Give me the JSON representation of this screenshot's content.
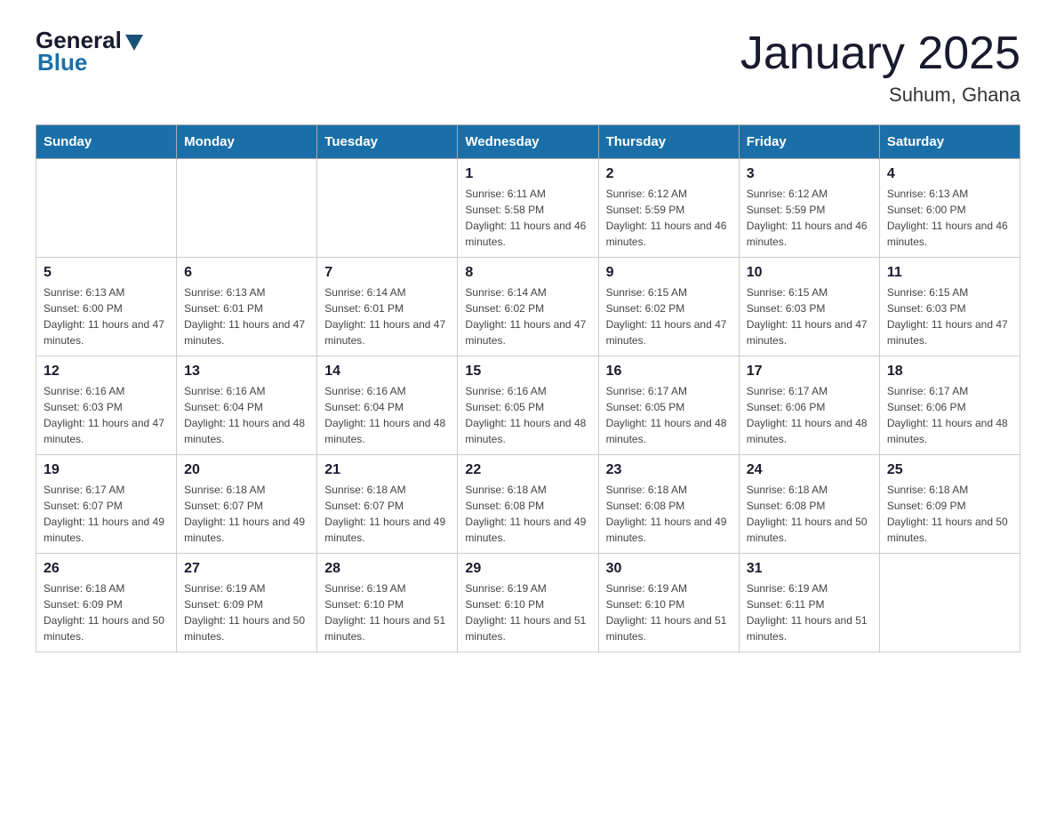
{
  "logo": {
    "general": "General",
    "blue": "Blue"
  },
  "title": "January 2025",
  "subtitle": "Suhum, Ghana",
  "days_header": [
    "Sunday",
    "Monday",
    "Tuesday",
    "Wednesday",
    "Thursday",
    "Friday",
    "Saturday"
  ],
  "weeks": [
    [
      {
        "day": "",
        "info": ""
      },
      {
        "day": "",
        "info": ""
      },
      {
        "day": "",
        "info": ""
      },
      {
        "day": "1",
        "info": "Sunrise: 6:11 AM\nSunset: 5:58 PM\nDaylight: 11 hours and 46 minutes."
      },
      {
        "day": "2",
        "info": "Sunrise: 6:12 AM\nSunset: 5:59 PM\nDaylight: 11 hours and 46 minutes."
      },
      {
        "day": "3",
        "info": "Sunrise: 6:12 AM\nSunset: 5:59 PM\nDaylight: 11 hours and 46 minutes."
      },
      {
        "day": "4",
        "info": "Sunrise: 6:13 AM\nSunset: 6:00 PM\nDaylight: 11 hours and 46 minutes."
      }
    ],
    [
      {
        "day": "5",
        "info": "Sunrise: 6:13 AM\nSunset: 6:00 PM\nDaylight: 11 hours and 47 minutes."
      },
      {
        "day": "6",
        "info": "Sunrise: 6:13 AM\nSunset: 6:01 PM\nDaylight: 11 hours and 47 minutes."
      },
      {
        "day": "7",
        "info": "Sunrise: 6:14 AM\nSunset: 6:01 PM\nDaylight: 11 hours and 47 minutes."
      },
      {
        "day": "8",
        "info": "Sunrise: 6:14 AM\nSunset: 6:02 PM\nDaylight: 11 hours and 47 minutes."
      },
      {
        "day": "9",
        "info": "Sunrise: 6:15 AM\nSunset: 6:02 PM\nDaylight: 11 hours and 47 minutes."
      },
      {
        "day": "10",
        "info": "Sunrise: 6:15 AM\nSunset: 6:03 PM\nDaylight: 11 hours and 47 minutes."
      },
      {
        "day": "11",
        "info": "Sunrise: 6:15 AM\nSunset: 6:03 PM\nDaylight: 11 hours and 47 minutes."
      }
    ],
    [
      {
        "day": "12",
        "info": "Sunrise: 6:16 AM\nSunset: 6:03 PM\nDaylight: 11 hours and 47 minutes."
      },
      {
        "day": "13",
        "info": "Sunrise: 6:16 AM\nSunset: 6:04 PM\nDaylight: 11 hours and 48 minutes."
      },
      {
        "day": "14",
        "info": "Sunrise: 6:16 AM\nSunset: 6:04 PM\nDaylight: 11 hours and 48 minutes."
      },
      {
        "day": "15",
        "info": "Sunrise: 6:16 AM\nSunset: 6:05 PM\nDaylight: 11 hours and 48 minutes."
      },
      {
        "day": "16",
        "info": "Sunrise: 6:17 AM\nSunset: 6:05 PM\nDaylight: 11 hours and 48 minutes."
      },
      {
        "day": "17",
        "info": "Sunrise: 6:17 AM\nSunset: 6:06 PM\nDaylight: 11 hours and 48 minutes."
      },
      {
        "day": "18",
        "info": "Sunrise: 6:17 AM\nSunset: 6:06 PM\nDaylight: 11 hours and 48 minutes."
      }
    ],
    [
      {
        "day": "19",
        "info": "Sunrise: 6:17 AM\nSunset: 6:07 PM\nDaylight: 11 hours and 49 minutes."
      },
      {
        "day": "20",
        "info": "Sunrise: 6:18 AM\nSunset: 6:07 PM\nDaylight: 11 hours and 49 minutes."
      },
      {
        "day": "21",
        "info": "Sunrise: 6:18 AM\nSunset: 6:07 PM\nDaylight: 11 hours and 49 minutes."
      },
      {
        "day": "22",
        "info": "Sunrise: 6:18 AM\nSunset: 6:08 PM\nDaylight: 11 hours and 49 minutes."
      },
      {
        "day": "23",
        "info": "Sunrise: 6:18 AM\nSunset: 6:08 PM\nDaylight: 11 hours and 49 minutes."
      },
      {
        "day": "24",
        "info": "Sunrise: 6:18 AM\nSunset: 6:08 PM\nDaylight: 11 hours and 50 minutes."
      },
      {
        "day": "25",
        "info": "Sunrise: 6:18 AM\nSunset: 6:09 PM\nDaylight: 11 hours and 50 minutes."
      }
    ],
    [
      {
        "day": "26",
        "info": "Sunrise: 6:18 AM\nSunset: 6:09 PM\nDaylight: 11 hours and 50 minutes."
      },
      {
        "day": "27",
        "info": "Sunrise: 6:19 AM\nSunset: 6:09 PM\nDaylight: 11 hours and 50 minutes."
      },
      {
        "day": "28",
        "info": "Sunrise: 6:19 AM\nSunset: 6:10 PM\nDaylight: 11 hours and 51 minutes."
      },
      {
        "day": "29",
        "info": "Sunrise: 6:19 AM\nSunset: 6:10 PM\nDaylight: 11 hours and 51 minutes."
      },
      {
        "day": "30",
        "info": "Sunrise: 6:19 AM\nSunset: 6:10 PM\nDaylight: 11 hours and 51 minutes."
      },
      {
        "day": "31",
        "info": "Sunrise: 6:19 AM\nSunset: 6:11 PM\nDaylight: 11 hours and 51 minutes."
      },
      {
        "day": "",
        "info": ""
      }
    ]
  ]
}
